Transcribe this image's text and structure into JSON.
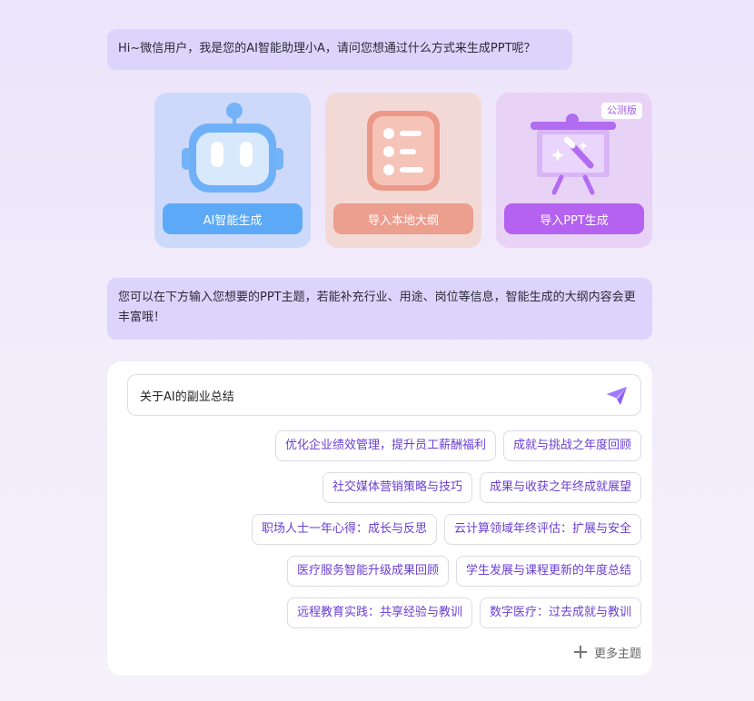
{
  "greeting": "Hi~微信用户，我是您的AI智能助理小A，请问您想通过什么方式来生成PPT呢？",
  "cards": [
    {
      "label": "AI智能生成",
      "icon": "robot-icon"
    },
    {
      "label": "导入本地大纲",
      "icon": "outline-list-icon"
    },
    {
      "label": "导入PPT生成",
      "icon": "presentation-board-icon",
      "badge": "公测版"
    }
  ],
  "hint": "您可以在下方输入您想要的PPT主题，若能补充行业、用途、岗位等信息，智能生成的大纲内容会更丰富哦！",
  "input": {
    "value": "关于AI的副业总结",
    "send_icon": "send-paper-plane-icon"
  },
  "topics": [
    [
      "优化企业绩效管理，提升员工薪酬福利",
      "成就与挑战之年度回顾"
    ],
    [
      "社交媒体营销策略与技巧",
      "成果与收获之年终成就展望"
    ],
    [
      "职场人士一年心得：成长与反思",
      "云计算领域年终评估：扩展与安全"
    ],
    [
      "医疗服务智能升级成果回顾",
      "学生发展与课程更新的年度总结"
    ],
    [
      "远程教育实践：共享经验与教训",
      "数字医疗：过去成就与教训"
    ]
  ],
  "more_label": "更多主题",
  "colors": {
    "ai_card": "#cdd9fb",
    "ai_button": "#5caaf7",
    "outline_card": "#f3d9d6",
    "outline_button": "#ec9e8f",
    "ppt_card": "#e8d3f6",
    "ppt_button": "#b562f0",
    "chip_text": "#6a3fd4",
    "bubble": "#ddd4fb"
  }
}
